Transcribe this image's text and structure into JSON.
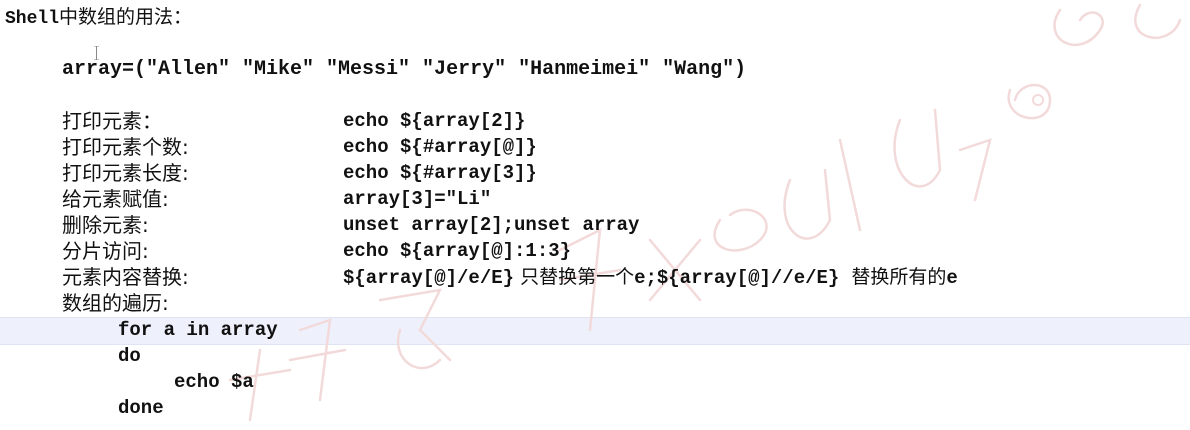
{
  "title": {
    "prefix": "Shell",
    "suffix": "中数组的用法："
  },
  "array_line": "array=(\"Allen\" \"Mike\" \"Messi\" \"Jerry\" \"Hanmeimei\" \"Wang\")",
  "rows": [
    {
      "label": "打印元素：",
      "cmd": "echo ${array[2]}"
    },
    {
      "label": "打印元素个数:",
      "cmd": "echo ${#array[@]}"
    },
    {
      "label": "打印元素长度:",
      "cmd": "echo ${#array[3]}"
    },
    {
      "label": "给元素赋值:",
      "cmd": "array[3]=\"Li\""
    },
    {
      "label": "删除元素:",
      "cmd": "unset array[2];unset array"
    },
    {
      "label": "分片访问:",
      "cmd": "echo ${array[@]:1:3}"
    },
    {
      "label": "元素内容替换:",
      "cmd_a": "${array[@]/e/E}",
      "note_a": " 只替换第一个",
      "cmd_b": "e;${array[@]//e/E}",
      "note_b": "  替换所有的",
      "cmd_c": "e"
    },
    {
      "label": "数组的遍历:"
    }
  ],
  "loop": {
    "line1": "for a in array",
    "line2": "do",
    "line3": "echo $a",
    "line4": "done"
  },
  "colors": {
    "text": "#111111",
    "highlight": "#eef0fb",
    "watermark": "#f3dada"
  }
}
